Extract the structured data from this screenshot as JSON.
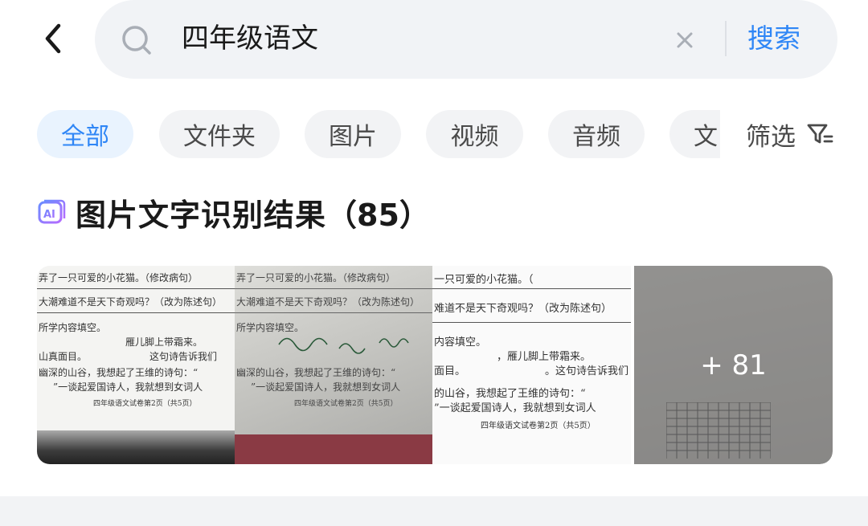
{
  "search": {
    "query": "四年级语文",
    "submit_label": "搜索"
  },
  "tabs": [
    {
      "label": "全部",
      "active": true
    },
    {
      "label": "文件夹",
      "active": false
    },
    {
      "label": "图片",
      "active": false
    },
    {
      "label": "视频",
      "active": false
    },
    {
      "label": "音频",
      "active": false
    },
    {
      "label": "文",
      "active": false
    }
  ],
  "filter": {
    "label": "筛选",
    "icon": "filter-icon"
  },
  "section": {
    "title": "图片文字识别结果",
    "count": "（85）",
    "icon": "ai-ocr-icon"
  },
  "thumbnails": {
    "more_label": "+ 81",
    "paper_text": {
      "line1": "弄了一只可爱的小花猫。（修改病句）",
      "line2": "大潮难道不是天下奇观吗？（改为陈述句）",
      "line3": "所学内容填空。",
      "line4": "雁儿脚上带霜来。",
      "line5": "山真面目。",
      "line6": "这句诗告诉我们",
      "line7": "幽深的山谷，我想起了王维的诗句：“",
      "line8": "”一谈起爱国诗人，我就想到女词人",
      "footer": "四年级语文试卷第2页（共5页）",
      "line1b": "一只可爱的小花猫。（",
      "line2b": "难道不是天下奇观吗？（改为陈述句）",
      "line3b": "内容填空。",
      "line4b": "，雁儿脚上带霜来。",
      "line5b": "面目。",
      "line6b": "。这句诗告诉我们",
      "line7b": "的山谷，我想起了王维的诗句：“",
      "line8b": "”一谈起爱国诗人，我就想到女词人"
    }
  },
  "colors": {
    "accent": "#2f86f6",
    "active_tab_bg": "#e9f3fe",
    "chip_bg": "#f2f3f5"
  }
}
